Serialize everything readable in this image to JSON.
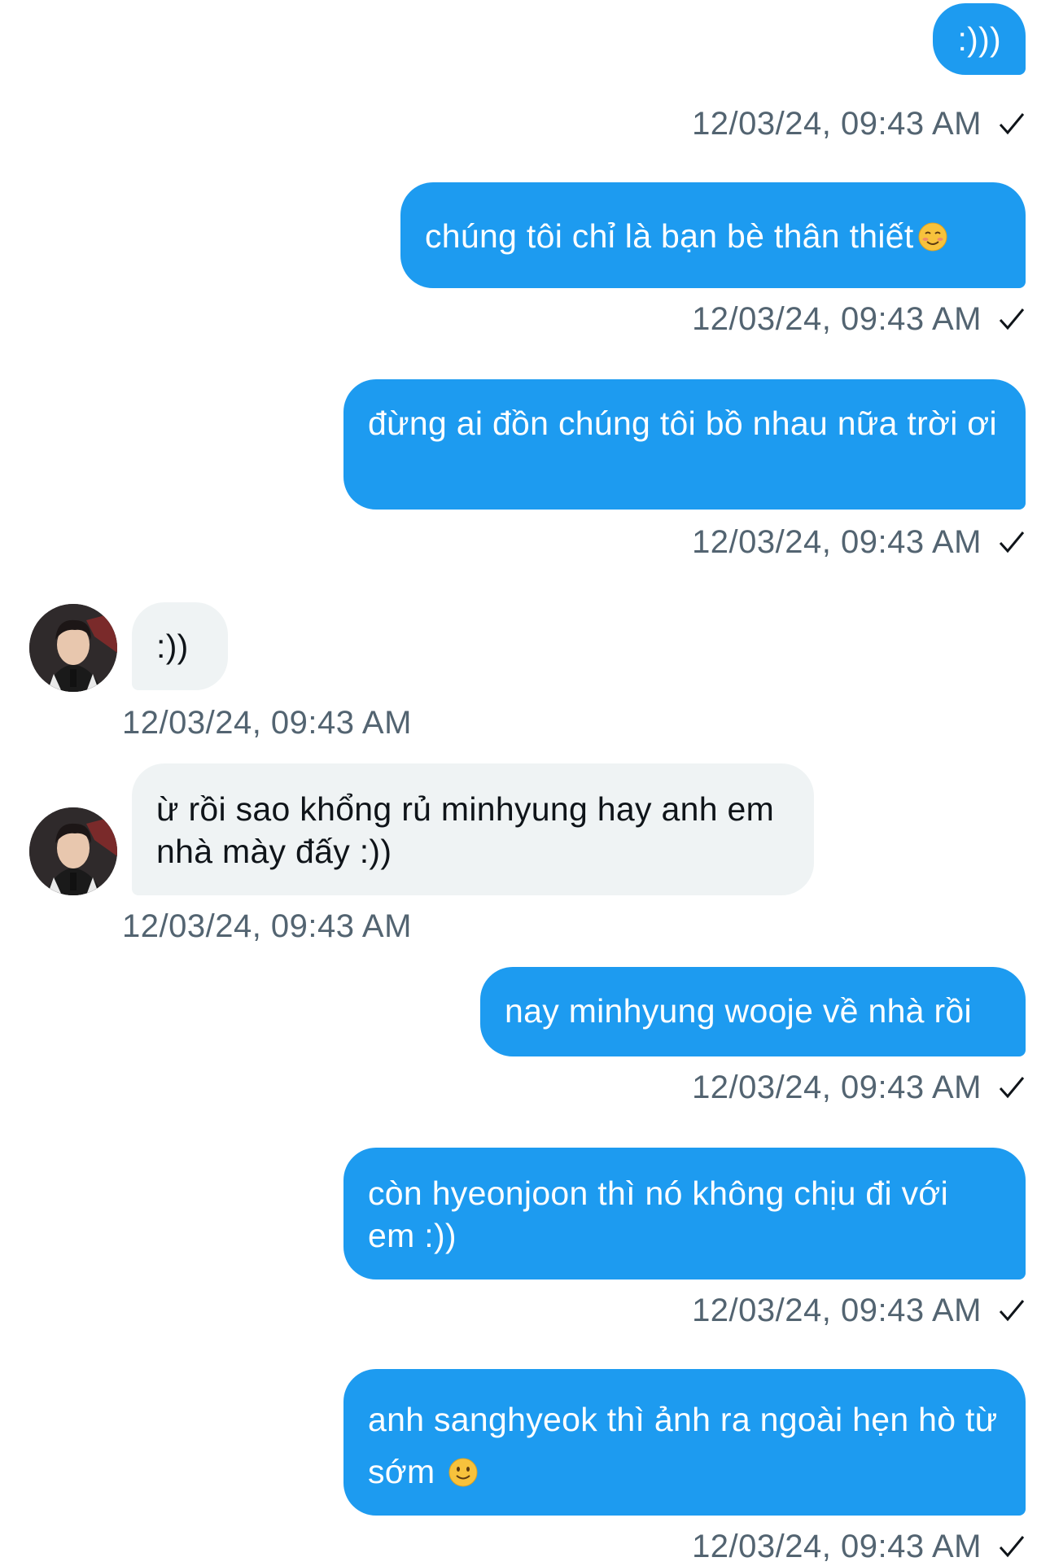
{
  "messages": [
    {
      "side": "out",
      "text": ":)))",
      "time": "12/03/24, 09:43 AM"
    },
    {
      "side": "out",
      "text": "chúng tôi chỉ là bạn bè thân thiết",
      "emoji": "smiling-face-icon",
      "time": "12/03/24, 09:43 AM"
    },
    {
      "side": "out",
      "text": "đừng ai đồn chúng tôi bồ nhau nữa trời ơi",
      "time": "12/03/24, 09:43 AM"
    },
    {
      "side": "in",
      "text": ":))",
      "time": "12/03/24, 09:43 AM"
    },
    {
      "side": "in",
      "text": "ừ rồi sao khổng rủ minhyung hay anh em nhà mày đấy :))",
      "time": "12/03/24, 09:43 AM"
    },
    {
      "side": "out",
      "text": "nay minhyung wooje về nhà rồi",
      "time": "12/03/24, 09:43 AM"
    },
    {
      "side": "out",
      "text": "còn hyeonjoon thì nó không chịu đi với em :))",
      "time": "12/03/24, 09:43 AM"
    },
    {
      "side": "out",
      "text": "anh sanghyeok thì ảnh ra ngoài hẹn hò từ sớm",
      "emoji": "slightly-smiling-face-icon",
      "time": "12/03/24, 09:43 AM"
    }
  ],
  "colors": {
    "outgoing_bubble": "#1d9bf0",
    "incoming_bubble": "#eff3f4",
    "timestamp": "#536471"
  }
}
